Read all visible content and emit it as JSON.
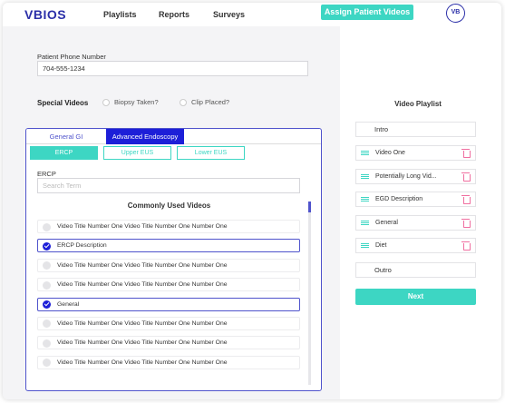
{
  "header": {
    "logo": "VBIOS",
    "nav": [
      "Playlists",
      "Reports",
      "Surveys"
    ],
    "assign_label": "Assign Patient Videos",
    "avatar": "VB"
  },
  "form": {
    "phone_label": "Patient Phone Number",
    "phone_value": "704-555-1234",
    "special_label": "Special Videos",
    "options": [
      "Biopsy Taken?",
      "Clip Placed?"
    ]
  },
  "panel": {
    "tabs": [
      "General GI",
      "Advanced Endoscopy"
    ],
    "active_tab": "Advanced Endoscopy",
    "subtabs": [
      "ERCP",
      "Upper EUS",
      "Lower EUS"
    ],
    "active_subtab": "ERCP",
    "section_label": "ERCP",
    "search_placeholder": "Search Term",
    "list_title": "Commonly Used Videos",
    "videos": [
      {
        "label": "Video Title Number One Video Title Number One Number One",
        "selected": false
      },
      {
        "label": "ERCP Description",
        "selected": true
      },
      {
        "label": "Video Title Number One Video Title Number One Number One",
        "selected": false
      },
      {
        "label": "Video Title Number One Video Title Number One Number One",
        "selected": false
      },
      {
        "label": "General",
        "selected": true
      },
      {
        "label": "Video Title Number One Video Title Number One Number One",
        "selected": false
      },
      {
        "label": "Video Title Number One Video Title Number One Number One",
        "selected": false
      },
      {
        "label": "Video Title Number One Video Title Number One Number One",
        "selected": false
      }
    ]
  },
  "playlist": {
    "title": "Video Playlist",
    "intro": "Intro",
    "items": [
      "Video One",
      "Potentially Long Vid...",
      "EGD Description",
      "General",
      "Diet"
    ],
    "outro": "Outro",
    "next_label": "Next"
  },
  "colors": {
    "brand": "#2b2fa8",
    "accent": "#3dd6c3",
    "active_tab": "#1d1fd8",
    "delete": "#f06fa0"
  },
  "icons": {
    "checkbox": "check-circle-icon",
    "drag": "drag-handle-icon",
    "delete": "trash-icon"
  }
}
